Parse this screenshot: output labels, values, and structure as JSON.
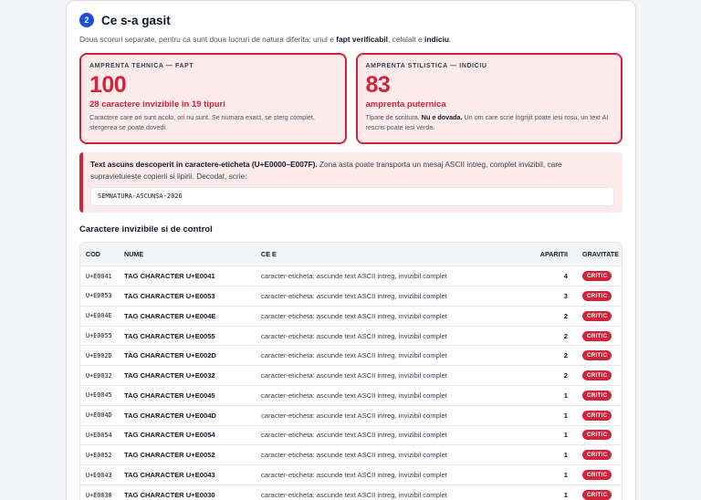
{
  "section": {
    "step": "2",
    "title": "Ce s-a gasit",
    "subtitle_pre": "Doua scoruri separate, pentru ca sunt doua lucruri de natura diferita: unul e ",
    "subtitle_b1": "fapt verificabil",
    "subtitle_mid": ", celalalt e ",
    "subtitle_b2": "indiciu",
    "subtitle_post": "."
  },
  "metrics": [
    {
      "label": "AMPRENTA TEHNICA — FAPT",
      "value": "100",
      "headline": "28 caractere invizibile in 19 tipuri",
      "desc": "Caractere care ori sunt acolo, ori nu sunt. Se numara exact, se sterg complet, stergerea se poate dovedi."
    },
    {
      "label": "AMPRENTA STILISTICA — INDICIU",
      "value": "83",
      "headline": "amprenta puternica",
      "desc_pre": "Tipare de scriitura. ",
      "desc_bold": "Nu e dovada.",
      "desc_post": " Un om care scrie ingrijit poate iesi rosu, un text AI rescris poate iesi verde."
    }
  ],
  "alert": {
    "title": "Text ascuns descoperit in caractere-eticheta (U+E0000–E007F).",
    "body": " Zona asta poate transporta un mesaj ASCII intreg, complet invizibil, care supravietuieste copierii si lipirii. Decodat, scrie:",
    "decoded": "SEMNATURA-ASCUNSA-2026"
  },
  "table": {
    "title": "Caractere invizibile si de control",
    "headers": {
      "code": "COD",
      "name": "NUME",
      "what": "CE E",
      "count": "APARITII",
      "severity": "GRAVITATE"
    },
    "rows": [
      {
        "code": "U+E0041",
        "name": "TAG CHARACTER U+E0041",
        "what": "caracter-eticheta: ascunde text ASCII intreg, invizibil complet",
        "count": "4",
        "severity": "CRITIC"
      },
      {
        "code": "U+E0053",
        "name": "TAG CHARACTER U+E0053",
        "what": "caracter-eticheta: ascunde text ASCII intreg, invizibil complet",
        "count": "3",
        "severity": "CRITIC"
      },
      {
        "code": "U+E004E",
        "name": "TAG CHARACTER U+E004E",
        "what": "caracter-eticheta: ascunde text ASCII intreg, invizibil complet",
        "count": "2",
        "severity": "CRITIC"
      },
      {
        "code": "U+E0055",
        "name": "TAG CHARACTER U+E0055",
        "what": "caracter-eticheta: ascunde text ASCII intreg, invizibil complet",
        "count": "2",
        "severity": "CRITIC"
      },
      {
        "code": "U+E002D",
        "name": "TAG CHARACTER U+E002D",
        "what": "caracter-eticheta: ascunde text ASCII intreg, invizibil complet",
        "count": "2",
        "severity": "CRITIC"
      },
      {
        "code": "U+E0032",
        "name": "TAG CHARACTER U+E0032",
        "what": "caracter-eticheta: ascunde text ASCII intreg, invizibil complet",
        "count": "2",
        "severity": "CRITIC"
      },
      {
        "code": "U+E0045",
        "name": "TAG CHARACTER U+E0045",
        "what": "caracter-eticheta: ascunde text ASCII intreg, invizibil complet",
        "count": "1",
        "severity": "CRITIC"
      },
      {
        "code": "U+E004D",
        "name": "TAG CHARACTER U+E004D",
        "what": "caracter-eticheta: ascunde text ASCII intreg, invizibil complet",
        "count": "1",
        "severity": "CRITIC"
      },
      {
        "code": "U+E0054",
        "name": "TAG CHARACTER U+E0054",
        "what": "caracter-eticheta: ascunde text ASCII intreg, invizibil complet",
        "count": "1",
        "severity": "CRITIC"
      },
      {
        "code": "U+E0052",
        "name": "TAG CHARACTER U+E0052",
        "what": "caracter-eticheta: ascunde text ASCII intreg, invizibil complet",
        "count": "1",
        "severity": "CRITIC"
      },
      {
        "code": "U+E0043",
        "name": "TAG CHARACTER U+E0043",
        "what": "caracter-eticheta: ascunde text ASCII intreg, invizibil complet",
        "count": "1",
        "severity": "CRITIC"
      },
      {
        "code": "U+E0030",
        "name": "TAG CHARACTER U+E0030",
        "what": "caracter-eticheta: ascunde text ASCII intreg, invizibil complet",
        "count": "1",
        "severity": "CRITIC"
      }
    ]
  },
  "colors": {
    "critical": "#d1243a",
    "accent": "#1d4ed8",
    "alert_bg": "#fdeaea"
  }
}
